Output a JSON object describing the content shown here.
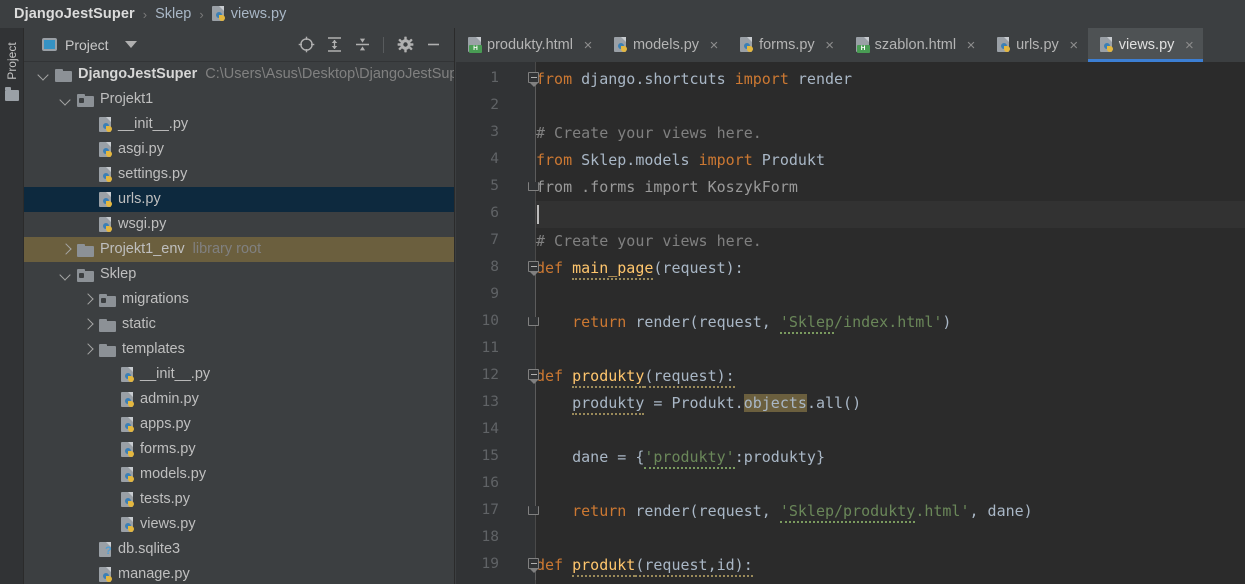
{
  "breadcrumb": {
    "root": "DjangoJestSuper",
    "separator": "›",
    "items": [
      "Sklep",
      "views.py"
    ]
  },
  "project_panel": {
    "title": "Project",
    "tool_strip_label": "Project",
    "toolbar_icons": [
      {
        "name": "locate-target-icon",
        "glyph": "⊕"
      },
      {
        "name": "expand-all-icon",
        "glyph": "⇵"
      },
      {
        "name": "collapse-all-icon",
        "glyph": "⇵"
      },
      {
        "name": "settings-gear-icon",
        "glyph": "⚙"
      },
      {
        "name": "hide-panel-icon",
        "glyph": "−"
      }
    ],
    "tree": [
      {
        "label": "DjangoJestSuper",
        "hint": "C:\\Users\\Asus\\Desktop\\DjangoJestSup",
        "indent": 0,
        "arrow": "down",
        "icon": "folder",
        "bold": true,
        "state": "normal"
      },
      {
        "label": "Projekt1",
        "hint": "",
        "indent": 1,
        "arrow": "down",
        "icon": "module-folder",
        "bold": false,
        "state": "normal"
      },
      {
        "label": "__init__.py",
        "hint": "",
        "indent": 2,
        "arrow": "none",
        "icon": "python",
        "bold": false,
        "state": "normal"
      },
      {
        "label": "asgi.py",
        "hint": "",
        "indent": 2,
        "arrow": "none",
        "icon": "python",
        "bold": false,
        "state": "normal"
      },
      {
        "label": "settings.py",
        "hint": "",
        "indent": 2,
        "arrow": "none",
        "icon": "python",
        "bold": false,
        "state": "normal"
      },
      {
        "label": "urls.py",
        "hint": "",
        "indent": 2,
        "arrow": "none",
        "icon": "python",
        "bold": false,
        "state": "selected"
      },
      {
        "label": "wsgi.py",
        "hint": "",
        "indent": 2,
        "arrow": "none",
        "icon": "python",
        "bold": false,
        "state": "normal"
      },
      {
        "label": "Projekt1_env",
        "hint": "library root",
        "indent": 1,
        "arrow": "right",
        "icon": "folder",
        "bold": false,
        "state": "library"
      },
      {
        "label": "Sklep",
        "hint": "",
        "indent": 1,
        "arrow": "down",
        "icon": "module-folder",
        "bold": false,
        "state": "normal"
      },
      {
        "label": "migrations",
        "hint": "",
        "indent": 2,
        "arrow": "right",
        "icon": "module-folder",
        "bold": false,
        "state": "normal"
      },
      {
        "label": "static",
        "hint": "",
        "indent": 2,
        "arrow": "right",
        "icon": "folder",
        "bold": false,
        "state": "normal"
      },
      {
        "label": "templates",
        "hint": "",
        "indent": 2,
        "arrow": "right",
        "icon": "folder",
        "bold": false,
        "state": "normal"
      },
      {
        "label": "__init__.py",
        "hint": "",
        "indent": 3,
        "arrow": "none",
        "icon": "python",
        "bold": false,
        "state": "normal"
      },
      {
        "label": "admin.py",
        "hint": "",
        "indent": 3,
        "arrow": "none",
        "icon": "python",
        "bold": false,
        "state": "normal"
      },
      {
        "label": "apps.py",
        "hint": "",
        "indent": 3,
        "arrow": "none",
        "icon": "python",
        "bold": false,
        "state": "normal"
      },
      {
        "label": "forms.py",
        "hint": "",
        "indent": 3,
        "arrow": "none",
        "icon": "python",
        "bold": false,
        "state": "normal"
      },
      {
        "label": "models.py",
        "hint": "",
        "indent": 3,
        "arrow": "none",
        "icon": "python",
        "bold": false,
        "state": "normal"
      },
      {
        "label": "tests.py",
        "hint": "",
        "indent": 3,
        "arrow": "none",
        "icon": "python",
        "bold": false,
        "state": "normal"
      },
      {
        "label": "views.py",
        "hint": "",
        "indent": 3,
        "arrow": "none",
        "icon": "python",
        "bold": false,
        "state": "normal"
      },
      {
        "label": "db.sqlite3",
        "hint": "",
        "indent": 2,
        "arrow": "none",
        "icon": "sqlite",
        "bold": false,
        "state": "normal"
      },
      {
        "label": "manage.py",
        "hint": "",
        "indent": 2,
        "arrow": "none",
        "icon": "python",
        "bold": false,
        "state": "normal"
      }
    ]
  },
  "editor": {
    "tabs": [
      {
        "label": "produkty.html",
        "icon": "html",
        "active": false,
        "close": "×"
      },
      {
        "label": "models.py",
        "icon": "python",
        "active": false,
        "close": "×"
      },
      {
        "label": "forms.py",
        "icon": "python",
        "active": false,
        "close": "×"
      },
      {
        "label": "szablon.html",
        "icon": "html",
        "active": false,
        "close": "×"
      },
      {
        "label": "urls.py",
        "icon": "python",
        "active": false,
        "close": "×"
      },
      {
        "label": "views.py",
        "icon": "python",
        "active": true,
        "close": "×"
      }
    ],
    "active_tab": "views.py",
    "caret_line": 6,
    "line_numbers": [
      1,
      2,
      3,
      4,
      5,
      6,
      7,
      8,
      9,
      10,
      11,
      12,
      13,
      14,
      15,
      16,
      17,
      18,
      19
    ],
    "lines": [
      {
        "n": 1,
        "text": "from django.shortcuts import render"
      },
      {
        "n": 2,
        "text": ""
      },
      {
        "n": 3,
        "text": "# Create your views here."
      },
      {
        "n": 4,
        "text": "from Sklep.models import Produkt"
      },
      {
        "n": 5,
        "text": "from .forms import KoszykForm"
      },
      {
        "n": 6,
        "text": ""
      },
      {
        "n": 7,
        "text": "# Create your views here."
      },
      {
        "n": 8,
        "text": "def main_page(request):"
      },
      {
        "n": 9,
        "text": ""
      },
      {
        "n": 10,
        "text": "    return render(request, 'Sklep/index.html')"
      },
      {
        "n": 11,
        "text": ""
      },
      {
        "n": 12,
        "text": "def produkty(request):"
      },
      {
        "n": 13,
        "text": "    produkty = Produkt.objects.all()"
      },
      {
        "n": 14,
        "text": ""
      },
      {
        "n": 15,
        "text": "    dane = {'produkty':produkty}"
      },
      {
        "n": 16,
        "text": ""
      },
      {
        "n": 17,
        "text": "    return render(request, 'Sklep/produkty.html', dane)"
      },
      {
        "n": 18,
        "text": ""
      },
      {
        "n": 19,
        "text": "def produkt(request,id):"
      }
    ]
  },
  "colors": {
    "editor_bg": "#2b2b2b",
    "panel_bg": "#3c3f41",
    "gutter_bg": "#313335",
    "selection_blue": "#0d293e",
    "library_tan": "#6b5f3e",
    "active_tab_underline": "#3c7fd4",
    "keyword_orange": "#cc7832",
    "function_yellow": "#ffc66d",
    "string_green": "#6a8759",
    "comment_gray": "#808080",
    "identifier": "#a9b7c6"
  }
}
